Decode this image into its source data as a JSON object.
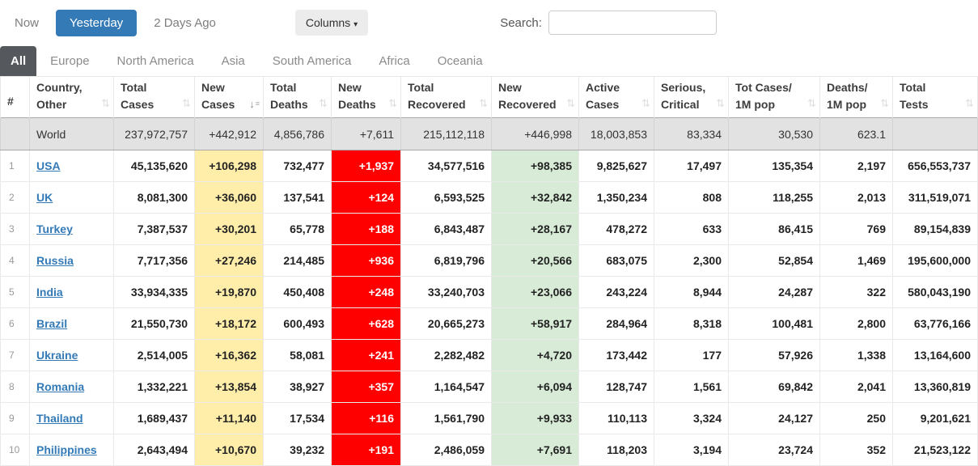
{
  "toolbar": {
    "now_label": "Now",
    "yesterday_label": "Yesterday",
    "two_days_ago_label": "2 Days Ago",
    "columns_label": "Columns",
    "search_label": "Search:",
    "search_value": ""
  },
  "active_view": "Yesterday",
  "tabs": [
    "All",
    "Europe",
    "North America",
    "Asia",
    "South America",
    "Africa",
    "Oceania"
  ],
  "active_tab": "All",
  "colors": {
    "accent_blue": "#337ab7",
    "new_cases_bg": "#ffeeaa",
    "new_deaths_bg": "#ff0000",
    "new_recovered_bg": "#d7ebd7",
    "world_row_bg": "#e2e2e2"
  },
  "table": {
    "headers": [
      {
        "id": "rank",
        "lines": [
          "#"
        ],
        "sort": "none"
      },
      {
        "id": "country-other",
        "lines": [
          "Country,",
          "Other"
        ],
        "sort": "inactive"
      },
      {
        "id": "total-cases",
        "lines": [
          "Total",
          "Cases"
        ],
        "sort": "inactive"
      },
      {
        "id": "new-cases",
        "lines": [
          "New",
          "Cases"
        ],
        "sort": "desc"
      },
      {
        "id": "total-deaths",
        "lines": [
          "Total",
          "Deaths"
        ],
        "sort": "inactive"
      },
      {
        "id": "new-deaths",
        "lines": [
          "New",
          "Deaths"
        ],
        "sort": "inactive"
      },
      {
        "id": "total-recovered",
        "lines": [
          "Total",
          "Recovered"
        ],
        "sort": "inactive"
      },
      {
        "id": "new-recovered",
        "lines": [
          "New",
          "Recovered"
        ],
        "sort": "inactive"
      },
      {
        "id": "active-cases",
        "lines": [
          "Active",
          "Cases"
        ],
        "sort": "inactive"
      },
      {
        "id": "serious-critical",
        "lines": [
          "Serious,",
          "Critical"
        ],
        "sort": "inactive"
      },
      {
        "id": "tot-cases-1m",
        "lines": [
          "Tot Cases/",
          "1M pop"
        ],
        "sort": "inactive"
      },
      {
        "id": "deaths-1m",
        "lines": [
          "Deaths/",
          "1M pop"
        ],
        "sort": "inactive"
      },
      {
        "id": "total-tests",
        "lines": [
          "Total",
          "Tests"
        ],
        "sort": "inactive"
      }
    ],
    "world_row": {
      "country": "World",
      "total_cases": "237,972,757",
      "new_cases": "+442,912",
      "total_deaths": "4,856,786",
      "new_deaths": "+7,611",
      "total_recovered": "215,112,118",
      "new_recovered": "+446,998",
      "active_cases": "18,003,853",
      "serious_critical": "83,334",
      "cases_per_1m": "30,530",
      "deaths_per_1m": "623.1",
      "total_tests": ""
    },
    "rows": [
      {
        "rank": "1",
        "country": "USA",
        "total_cases": "45,135,620",
        "new_cases": "+106,298",
        "total_deaths": "732,477",
        "new_deaths": "+1,937",
        "total_recovered": "34,577,516",
        "new_recovered": "+98,385",
        "active_cases": "9,825,627",
        "serious_critical": "17,497",
        "cases_per_1m": "135,354",
        "deaths_per_1m": "2,197",
        "total_tests": "656,553,737"
      },
      {
        "rank": "2",
        "country": "UK",
        "total_cases": "8,081,300",
        "new_cases": "+36,060",
        "total_deaths": "137,541",
        "new_deaths": "+124",
        "total_recovered": "6,593,525",
        "new_recovered": "+32,842",
        "active_cases": "1,350,234",
        "serious_critical": "808",
        "cases_per_1m": "118,255",
        "deaths_per_1m": "2,013",
        "total_tests": "311,519,071"
      },
      {
        "rank": "3",
        "country": "Turkey",
        "total_cases": "7,387,537",
        "new_cases": "+30,201",
        "total_deaths": "65,778",
        "new_deaths": "+188",
        "total_recovered": "6,843,487",
        "new_recovered": "+28,167",
        "active_cases": "478,272",
        "serious_critical": "633",
        "cases_per_1m": "86,415",
        "deaths_per_1m": "769",
        "total_tests": "89,154,839"
      },
      {
        "rank": "4",
        "country": "Russia",
        "total_cases": "7,717,356",
        "new_cases": "+27,246",
        "total_deaths": "214,485",
        "new_deaths": "+936",
        "total_recovered": "6,819,796",
        "new_recovered": "+20,566",
        "active_cases": "683,075",
        "serious_critical": "2,300",
        "cases_per_1m": "52,854",
        "deaths_per_1m": "1,469",
        "total_tests": "195,600,000"
      },
      {
        "rank": "5",
        "country": "India",
        "total_cases": "33,934,335",
        "new_cases": "+19,870",
        "total_deaths": "450,408",
        "new_deaths": "+248",
        "total_recovered": "33,240,703",
        "new_recovered": "+23,066",
        "active_cases": "243,224",
        "serious_critical": "8,944",
        "cases_per_1m": "24,287",
        "deaths_per_1m": "322",
        "total_tests": "580,043,190"
      },
      {
        "rank": "6",
        "country": "Brazil",
        "total_cases": "21,550,730",
        "new_cases": "+18,172",
        "total_deaths": "600,493",
        "new_deaths": "+628",
        "total_recovered": "20,665,273",
        "new_recovered": "+58,917",
        "active_cases": "284,964",
        "serious_critical": "8,318",
        "cases_per_1m": "100,481",
        "deaths_per_1m": "2,800",
        "total_tests": "63,776,166"
      },
      {
        "rank": "7",
        "country": "Ukraine",
        "total_cases": "2,514,005",
        "new_cases": "+16,362",
        "total_deaths": "58,081",
        "new_deaths": "+241",
        "total_recovered": "2,282,482",
        "new_recovered": "+4,720",
        "active_cases": "173,442",
        "serious_critical": "177",
        "cases_per_1m": "57,926",
        "deaths_per_1m": "1,338",
        "total_tests": "13,164,600"
      },
      {
        "rank": "8",
        "country": "Romania",
        "total_cases": "1,332,221",
        "new_cases": "+13,854",
        "total_deaths": "38,927",
        "new_deaths": "+357",
        "total_recovered": "1,164,547",
        "new_recovered": "+6,094",
        "active_cases": "128,747",
        "serious_critical": "1,561",
        "cases_per_1m": "69,842",
        "deaths_per_1m": "2,041",
        "total_tests": "13,360,819"
      },
      {
        "rank": "9",
        "country": "Thailand",
        "total_cases": "1,689,437",
        "new_cases": "+11,140",
        "total_deaths": "17,534",
        "new_deaths": "+116",
        "total_recovered": "1,561,790",
        "new_recovered": "+9,933",
        "active_cases": "110,113",
        "serious_critical": "3,324",
        "cases_per_1m": "24,127",
        "deaths_per_1m": "250",
        "total_tests": "9,201,621"
      },
      {
        "rank": "10",
        "country": "Philippines",
        "total_cases": "2,643,494",
        "new_cases": "+10,670",
        "total_deaths": "39,232",
        "new_deaths": "+191",
        "total_recovered": "2,486,059",
        "new_recovered": "+7,691",
        "active_cases": "118,203",
        "serious_critical": "3,194",
        "cases_per_1m": "23,724",
        "deaths_per_1m": "352",
        "total_tests": "21,523,122"
      }
    ]
  }
}
